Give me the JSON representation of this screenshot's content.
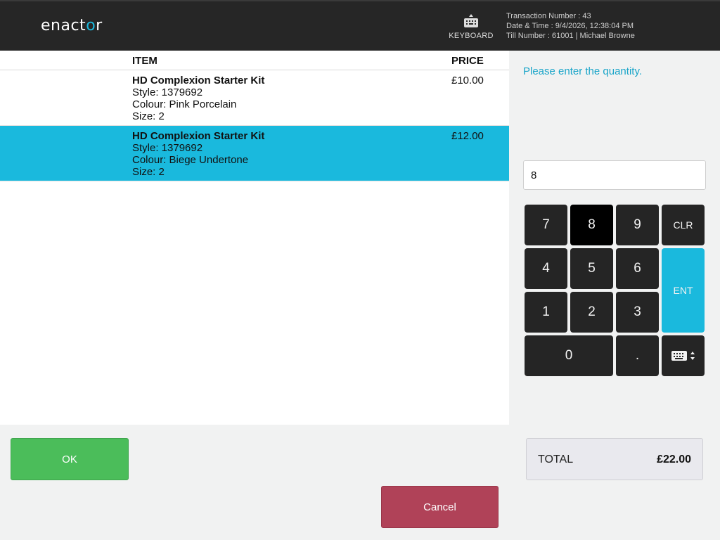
{
  "header": {
    "logo_text_1": "enact",
    "logo_text_2": "o",
    "logo_text_3": "r",
    "keyboard_label": "KEYBOARD",
    "transaction_number": "Transaction Number : 43",
    "date_time": "Date & Time : 9/4/2026, 12:38:04 PM",
    "till_user": "Till Number : 61001  |  Michael Browne"
  },
  "list": {
    "col_item": "ITEM",
    "col_price": "PRICE",
    "rows": [
      {
        "name": "HD Complexion Starter Kit",
        "style": "Style: 1379692",
        "colour": "Colour: Pink Porcelain",
        "size": "Size: 2",
        "price": "£10.00",
        "selected": false
      },
      {
        "name": "HD Complexion Starter Kit",
        "style": "Style: 1379692",
        "colour": "Colour: Biege Undertone",
        "size": "Size: 2",
        "price": "£12.00",
        "selected": true
      }
    ]
  },
  "quantity": {
    "prompt": "Please enter the quantity.",
    "value": "8"
  },
  "keypad": {
    "k7": "7",
    "k8": "8",
    "k9": "9",
    "clr": "CLR",
    "k4": "4",
    "k5": "5",
    "k6": "6",
    "ent": "ENT",
    "k1": "1",
    "k2": "2",
    "k3": "3",
    "k0": "0",
    "dot": "."
  },
  "total": {
    "label": "TOTAL",
    "value": "£22.00"
  },
  "actions": {
    "ok": "OK",
    "cancel": "Cancel"
  },
  "colors": {
    "accent": "#1ab9dd",
    "header_bg": "#262626",
    "ok_green": "#4bbd5a",
    "cancel_red": "#b04258",
    "key_bg": "#252525"
  }
}
